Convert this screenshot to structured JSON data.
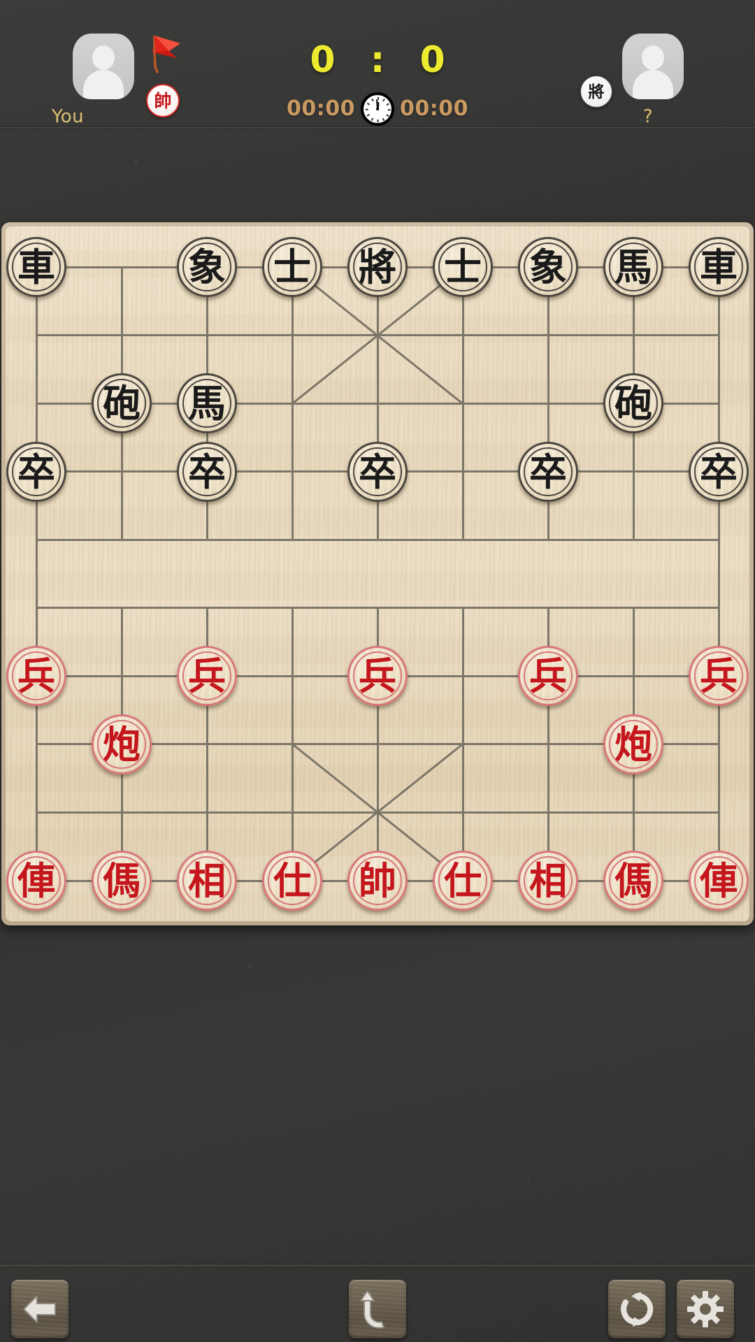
{
  "header": {
    "score": "0 : 0",
    "left_player": {
      "name": "You",
      "side_chip": "帥",
      "flag_icon": "red-flag-icon",
      "avatar_icon": "avatar-placeholder-icon"
    },
    "right_player": {
      "name": "?",
      "side_chip": "將",
      "avatar_icon": "avatar-placeholder-icon"
    },
    "clock": {
      "left_time": "00:00",
      "right_time": "00:00",
      "icon": "clock-icon"
    },
    "colors": {
      "score_yellow": "#edeb2f",
      "name_gold": "#d9c171",
      "clock_tan": "#c99a62",
      "red_piece": "#c4161c",
      "black_piece": "#1a1a1a"
    }
  },
  "board": {
    "files": 9,
    "ranks": 10,
    "pieces": [
      {
        "name": "black-chariot-left",
        "glyph": "車",
        "side": "black",
        "file": 0,
        "rank": 0
      },
      {
        "name": "black-elephant-left",
        "glyph": "象",
        "side": "black",
        "file": 2,
        "rank": 0
      },
      {
        "name": "black-advisor-left",
        "glyph": "士",
        "side": "black",
        "file": 3,
        "rank": 0
      },
      {
        "name": "black-general",
        "glyph": "將",
        "side": "black",
        "file": 4,
        "rank": 0
      },
      {
        "name": "black-advisor-right",
        "glyph": "士",
        "side": "black",
        "file": 5,
        "rank": 0
      },
      {
        "name": "black-elephant-right",
        "glyph": "象",
        "side": "black",
        "file": 6,
        "rank": 0
      },
      {
        "name": "black-horse-right",
        "glyph": "馬",
        "side": "black",
        "file": 7,
        "rank": 0
      },
      {
        "name": "black-chariot-right",
        "glyph": "車",
        "side": "black",
        "file": 8,
        "rank": 0
      },
      {
        "name": "black-cannon-left",
        "glyph": "砲",
        "side": "black",
        "file": 1,
        "rank": 2
      },
      {
        "name": "black-horse-left",
        "glyph": "馬",
        "side": "black",
        "file": 2,
        "rank": 2
      },
      {
        "name": "black-cannon-right",
        "glyph": "砲",
        "side": "black",
        "file": 7,
        "rank": 2
      },
      {
        "name": "black-soldier-1",
        "glyph": "卒",
        "side": "black",
        "file": 0,
        "rank": 3
      },
      {
        "name": "black-soldier-2",
        "glyph": "卒",
        "side": "black",
        "file": 2,
        "rank": 3
      },
      {
        "name": "black-soldier-3",
        "glyph": "卒",
        "side": "black",
        "file": 4,
        "rank": 3
      },
      {
        "name": "black-soldier-4",
        "glyph": "卒",
        "side": "black",
        "file": 6,
        "rank": 3
      },
      {
        "name": "black-soldier-5",
        "glyph": "卒",
        "side": "black",
        "file": 8,
        "rank": 3
      },
      {
        "name": "red-soldier-1",
        "glyph": "兵",
        "side": "red",
        "file": 0,
        "rank": 6
      },
      {
        "name": "red-soldier-2",
        "glyph": "兵",
        "side": "red",
        "file": 2,
        "rank": 6
      },
      {
        "name": "red-soldier-3",
        "glyph": "兵",
        "side": "red",
        "file": 4,
        "rank": 6
      },
      {
        "name": "red-soldier-4",
        "glyph": "兵",
        "side": "red",
        "file": 6,
        "rank": 6
      },
      {
        "name": "red-soldier-5",
        "glyph": "兵",
        "side": "red",
        "file": 8,
        "rank": 6
      },
      {
        "name": "red-cannon-left",
        "glyph": "炮",
        "side": "red",
        "file": 1,
        "rank": 7
      },
      {
        "name": "red-cannon-right",
        "glyph": "炮",
        "side": "red",
        "file": 7,
        "rank": 7
      },
      {
        "name": "red-chariot-left",
        "glyph": "俥",
        "side": "red",
        "file": 0,
        "rank": 9
      },
      {
        "name": "red-horse-left",
        "glyph": "傌",
        "side": "red",
        "file": 1,
        "rank": 9
      },
      {
        "name": "red-elephant-left",
        "glyph": "相",
        "side": "red",
        "file": 2,
        "rank": 9
      },
      {
        "name": "red-advisor-left",
        "glyph": "仕",
        "side": "red",
        "file": 3,
        "rank": 9
      },
      {
        "name": "red-general",
        "glyph": "帥",
        "side": "red",
        "file": 4,
        "rank": 9
      },
      {
        "name": "red-advisor-right",
        "glyph": "仕",
        "side": "red",
        "file": 5,
        "rank": 9
      },
      {
        "name": "red-elephant-right",
        "glyph": "相",
        "side": "red",
        "file": 6,
        "rank": 9
      },
      {
        "name": "red-horse-right",
        "glyph": "傌",
        "side": "red",
        "file": 7,
        "rank": 9
      },
      {
        "name": "red-chariot-right",
        "glyph": "俥",
        "side": "red",
        "file": 8,
        "rank": 9
      }
    ]
  },
  "toolbar": {
    "buttons": [
      {
        "name": "back-button",
        "icon": "arrow-left-icon"
      },
      {
        "name": "undo-button",
        "icon": "undo-arrow-icon"
      },
      {
        "name": "refresh-button",
        "icon": "refresh-icon"
      },
      {
        "name": "settings-button",
        "icon": "gear-icon"
      }
    ]
  }
}
